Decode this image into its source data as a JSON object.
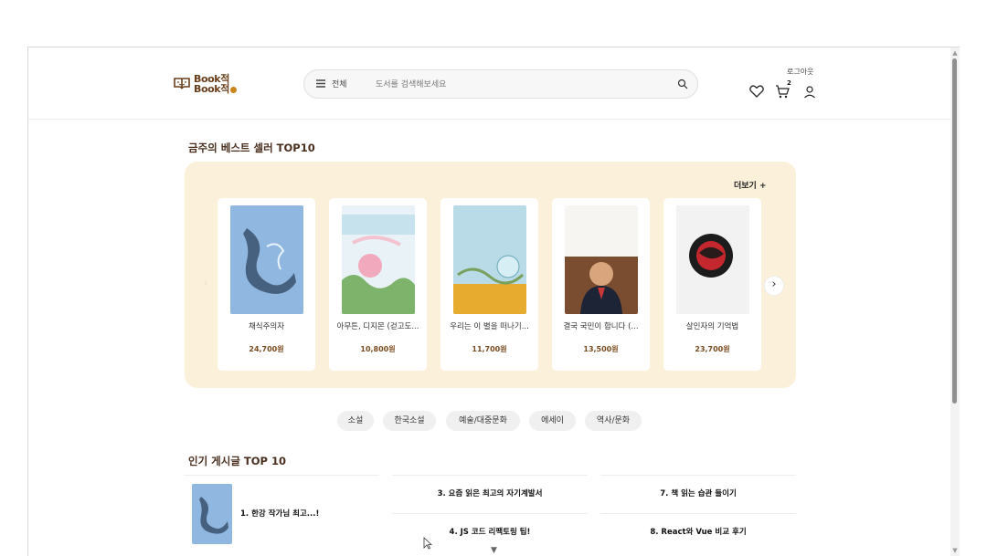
{
  "header": {
    "logo_line1": "Book적",
    "logo_line2": "Book적",
    "category": "전체",
    "search_placeholder": "도서를 검색해보세요",
    "logout": "로그아웃",
    "cart_count": "2"
  },
  "bestsellers": {
    "title": "금주의 베스트 셀러 TOP10",
    "more": "더보기 +",
    "items": [
      {
        "title": "채식주의자",
        "price": "24,700원"
      },
      {
        "title": "아무튼, 디지몬 (걷고도...",
        "price": "10,800원"
      },
      {
        "title": "우리는 이 별을 떠나기...",
        "price": "11,700원"
      },
      {
        "title": "결국 국민이 합니다 (...",
        "price": "13,500원"
      },
      {
        "title": "살인자의 기억법",
        "price": "23,700원"
      }
    ]
  },
  "categories": [
    "소설",
    "한국소설",
    "예술/대중문화",
    "에세이",
    "역사/문화"
  ],
  "board": {
    "title": "인기 게시글 TOP 10",
    "first": "1. 한강 작가님 최고...!",
    "col2": [
      "3. 요즘 읽은 최고의 자기계발서",
      "4. JS 코드 리팩토링 팁!"
    ],
    "col3": [
      "7. 책 읽는 습관 들이기",
      "8. React와 Vue 비교 후기"
    ]
  },
  "colors": {
    "brand": "#6a3e1a",
    "panel": "#fbf0da",
    "price": "#7a4b1e"
  }
}
